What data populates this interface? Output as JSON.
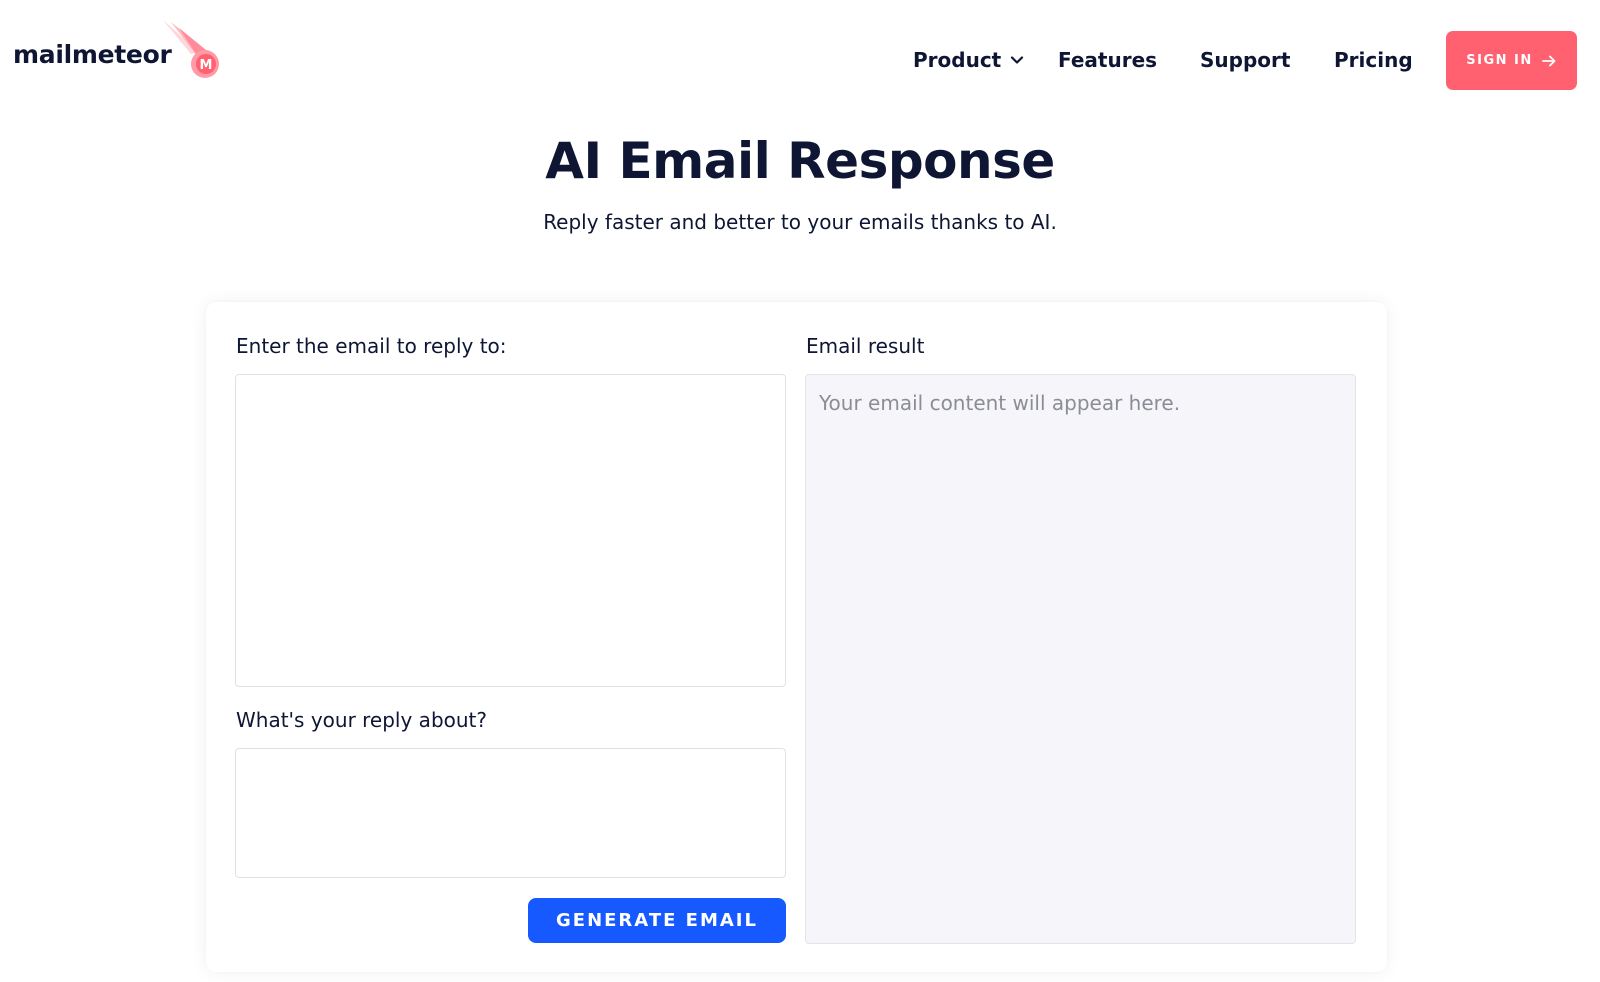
{
  "brand": {
    "name": "mailmeteor",
    "logo_letter": "M",
    "accent": "#ff6170"
  },
  "nav": {
    "product": "Product",
    "features": "Features",
    "support": "Support",
    "pricing": "Pricing",
    "sign_in": "SIGN IN"
  },
  "hero": {
    "title": "AI Email Response",
    "subtitle": "Reply faster and better to your emails thanks to AI."
  },
  "form": {
    "email_label": "Enter the email to reply to:",
    "email_value": "",
    "about_label": "What's your reply about?",
    "about_value": "",
    "generate_label": "GENERATE EMAIL",
    "generate_color": "#1659ff"
  },
  "result": {
    "label": "Email result",
    "placeholder": "Your email content will appear here."
  },
  "icons": {
    "product_chevron": "chevron-down-icon",
    "sign_in_arrow": "arrow-right-icon"
  }
}
